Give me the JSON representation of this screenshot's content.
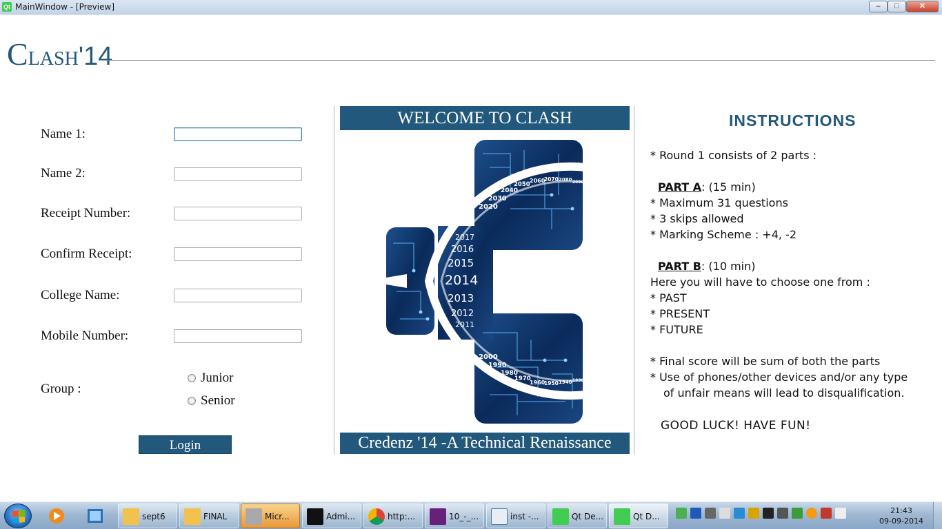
{
  "window": {
    "title": "MainWindow - [Preview]",
    "app_icon": "Qt"
  },
  "header": {
    "logo_c": "C",
    "logo_lash": "LASH",
    "logo_num": "'14"
  },
  "form": {
    "fields": [
      {
        "label": "Name 1:",
        "value": ""
      },
      {
        "label": "Name 2:",
        "value": ""
      },
      {
        "label": "Receipt Number:",
        "value": ""
      },
      {
        "label": "Confirm Receipt:",
        "value": ""
      },
      {
        "label": "College Name:",
        "value": ""
      },
      {
        "label": "Mobile Number:",
        "value": ""
      }
    ],
    "group_label": "Group :",
    "group_options": [
      "Junior",
      "Senior"
    ],
    "login_label": "Login"
  },
  "center": {
    "welcome": "WELCOME TO CLASH",
    "tagline": "Credenz '14 -A Technical Renaissance",
    "years_upper": [
      "2020",
      "2030",
      "2040",
      "2050",
      "2060",
      "2070",
      "2080",
      "2090"
    ],
    "years_middle": [
      "2017",
      "2016",
      "2015",
      "2014",
      "2013",
      "2012",
      "2011"
    ],
    "years_lower": [
      "2000",
      "1990",
      "1980",
      "1970",
      "1960",
      "1950",
      "1940",
      "1930"
    ],
    "accent_color": "#21587b"
  },
  "instructions": {
    "title": "INSTRUCTIONS",
    "round": "*  Round 1 consists of 2 parts :",
    "part_a_label": "PART A",
    "part_a_time": ": (15 min)",
    "part_a_items": [
      "*  Maximum 31 questions",
      "*  3 skips allowed",
      "*  Marking Scheme : +4, -2"
    ],
    "part_b_label": "PART B",
    "part_b_time": ": (10 min)",
    "part_b_intro": " Here you will have to  choose one from   :",
    "part_b_items": [
      "*  PAST",
      "*  PRESENT",
      "*  FUTURE"
    ],
    "final_score": "*  Final score will be sum of both the parts",
    "phones_1": "*  Use of phones/other devices and/or any type",
    "phones_2": "of   unfair means will lead to disqualification.",
    "good_luck": "GOOD LUCK!  HAVE FUN!"
  },
  "taskbar": {
    "tasks": [
      {
        "label": "sept6",
        "icon": "folder-icon"
      },
      {
        "label": "FINAL",
        "icon": "folder-icon"
      },
      {
        "label": "Micr...",
        "icon": "drive-icon"
      },
      {
        "label": "Admi...",
        "icon": "cmd-icon"
      },
      {
        "label": "http:...",
        "icon": "chrome-icon"
      },
      {
        "label": "10_-_...",
        "icon": "visual-studio-icon"
      },
      {
        "label": "inst -...",
        "icon": "wordpad-icon"
      },
      {
        "label": "Qt De...",
        "icon": "qt-icon"
      },
      {
        "label": "Qt D...",
        "icon": "qt-icon"
      }
    ],
    "time": "21:43",
    "date": "09-09-2014"
  }
}
